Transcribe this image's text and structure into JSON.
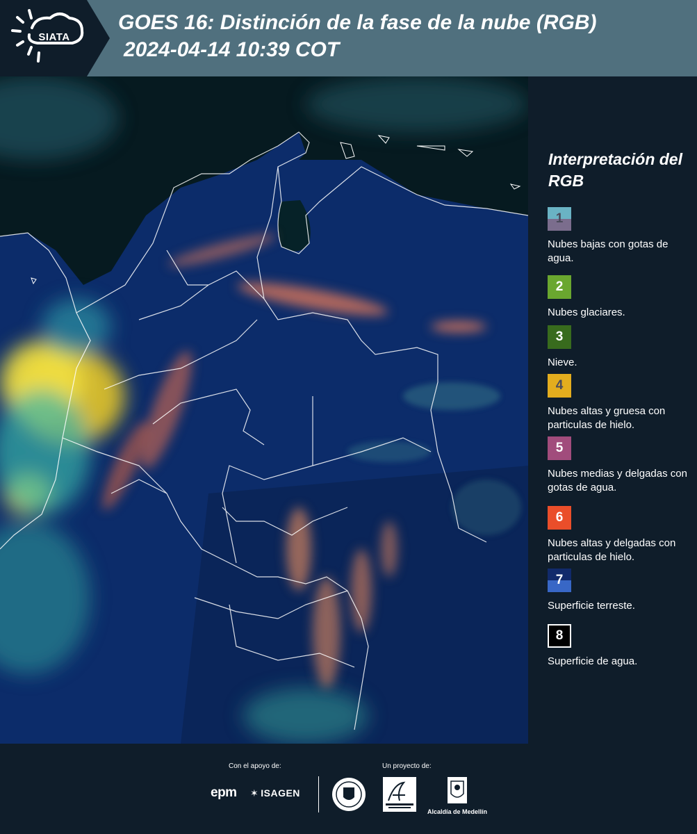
{
  "header": {
    "logo": "SIATA",
    "title_line1": "GOES 16: Distinción de la fase de la nube (RGB)",
    "title_line2": "2024-04-14 10:39 COT"
  },
  "map": {
    "type": "satellite-rgb-cloud-phase",
    "region": "Colombia",
    "boundary_color": "#ffffff",
    "ocean_color": "#061a20",
    "land_color": "#0c2c6a"
  },
  "legend": {
    "title": "Interpretación del RGB",
    "items": [
      {
        "num": "1",
        "top_color": "#6ab3c4",
        "bottom_color": "#7b6d8d",
        "num_color": "#4a4a5a",
        "label": "Nubes bajas con gotas de agua."
      },
      {
        "num": "2",
        "color": "#6aa72f",
        "num_color": "#ffffff",
        "label": "Nubes glaciares."
      },
      {
        "num": "3",
        "color": "#386b1d",
        "num_color": "#ffffff",
        "label": "Nieve."
      },
      {
        "num": "4",
        "color": "#e3ad1e",
        "num_color": "#4a4a5a",
        "label": "Nubes altas y gruesa con particulas de hielo."
      },
      {
        "num": "5",
        "color": "#a14c7c",
        "num_color": "#ffffff",
        "label": "Nubes medias y delgadas con gotas de agua."
      },
      {
        "num": "6",
        "color": "#ea4e2a",
        "num_color": "#ffffff",
        "label": "Nubes altas y delgadas con particulas de hielo."
      },
      {
        "num": "7",
        "top_color": "#112a6b",
        "bottom_color": "#3867c6",
        "num_color": "#ffffff",
        "label": "Superficie terreste."
      },
      {
        "num": "8",
        "color": "#000000",
        "num_color": "#ffffff",
        "border": "#ffffff",
        "label": "Superficie de agua."
      }
    ]
  },
  "footer": {
    "support_label": "Con el apoyo de:",
    "project_label": "Un proyecto de:",
    "epm_logo": "epm",
    "isagen_logo": "ISAGEN",
    "area_logo": "Área METROPOLITANA Valle de Aburrá",
    "alcaldia": "Alcaldía de Medellín"
  }
}
